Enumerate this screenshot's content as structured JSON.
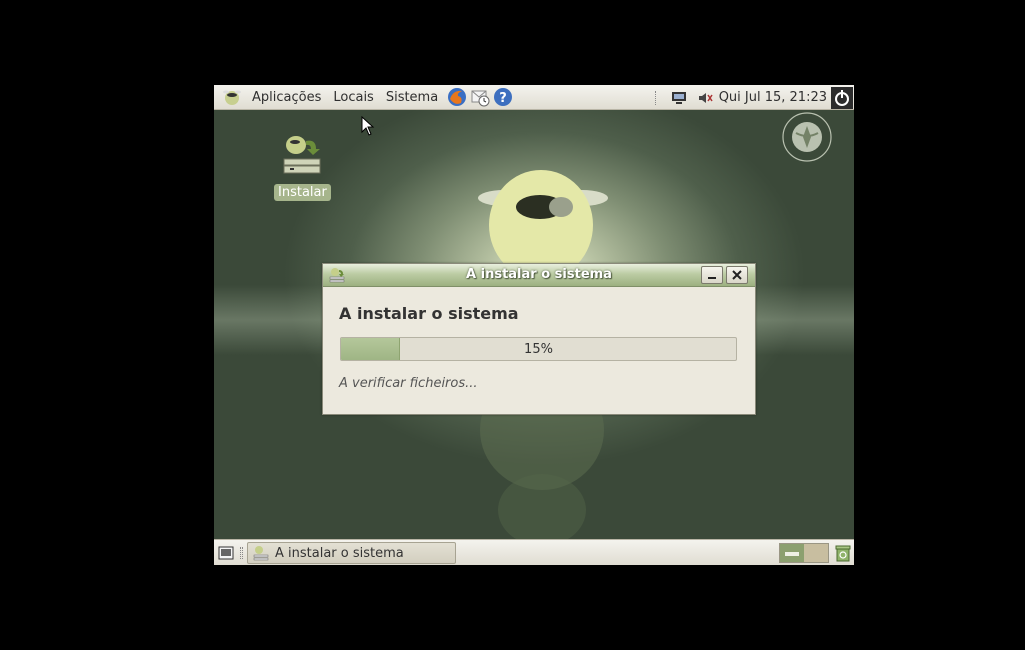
{
  "top_panel": {
    "menus": [
      "Aplicações",
      "Locais",
      "Sistema"
    ],
    "clock": "Qui Jul 15, 21:23",
    "launchers": [
      "firefox-icon",
      "mail-clock-icon",
      "help-icon"
    ]
  },
  "desktop": {
    "icon_label": "Instalar"
  },
  "dialog": {
    "title": "A instalar o sistema",
    "heading": "A instalar o sistema",
    "progress_percent": 15,
    "progress_label": "15%",
    "status": "A verificar ficheiros..."
  },
  "taskbar": {
    "task_label": "A instalar o sistema"
  },
  "colors": {
    "panel": "#e9e7dd",
    "accent_green": "#a6b58c",
    "dialog_bg": "#ece9de"
  }
}
